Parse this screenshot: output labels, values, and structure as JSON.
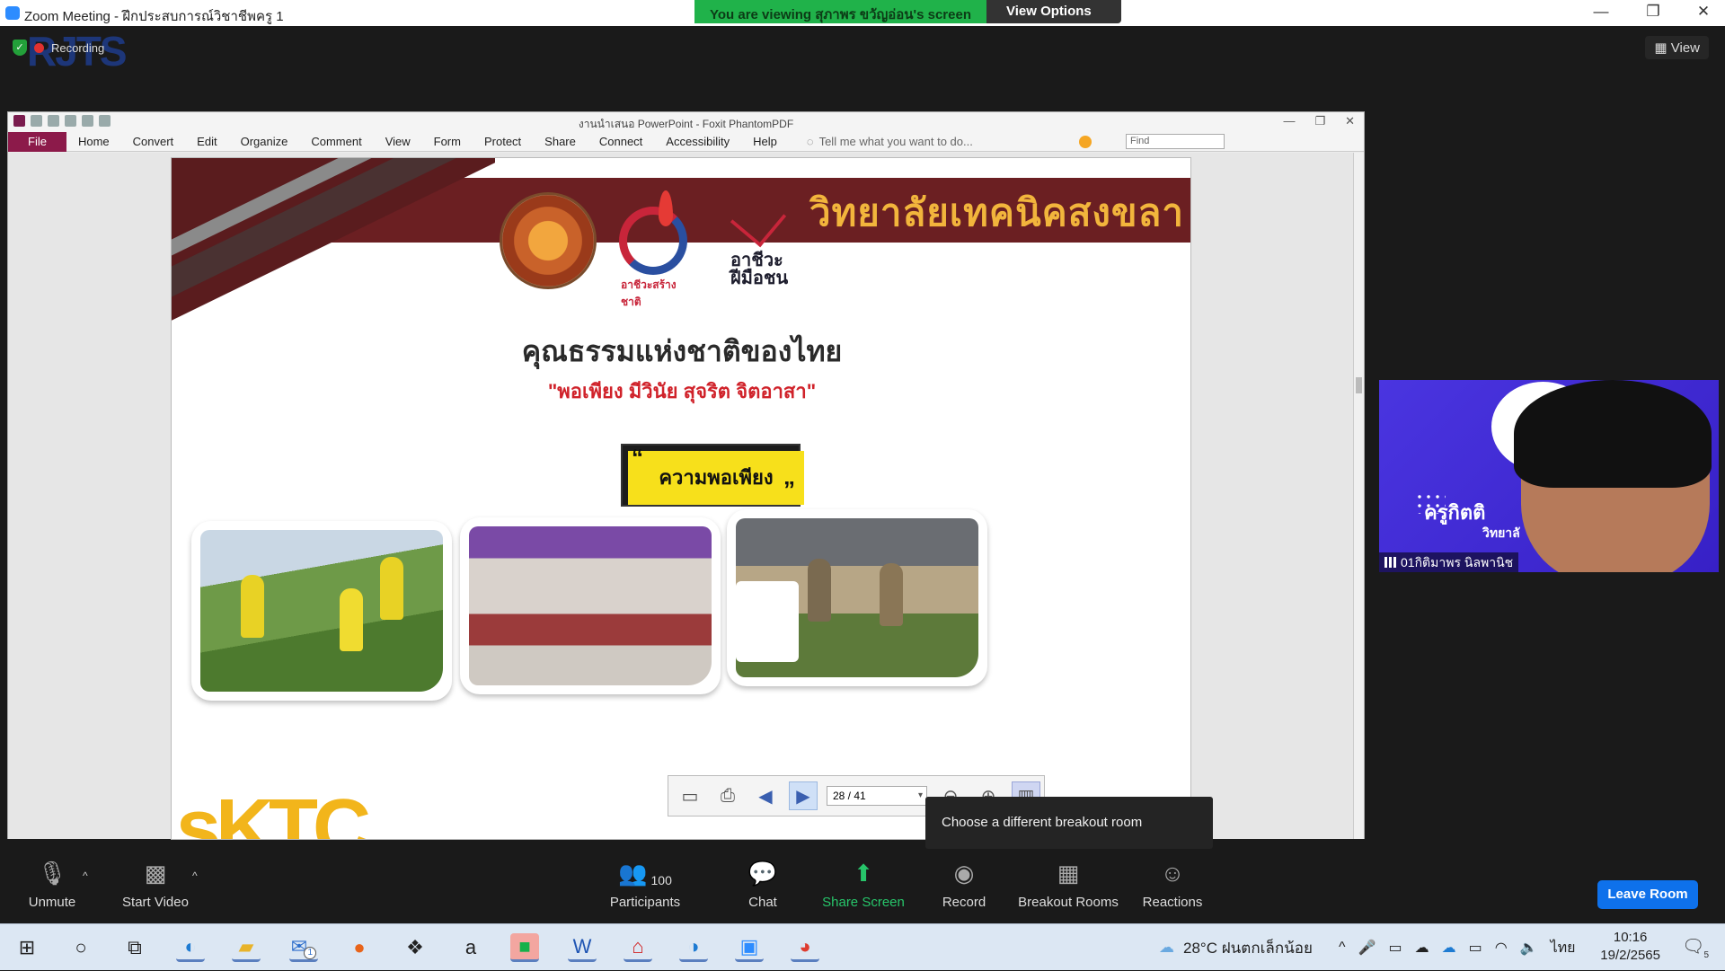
{
  "window": {
    "title": "Zoom Meeting - ฝึกประสบการณ์วิชาชีพครู 1",
    "minimize": "—",
    "restore": "❐",
    "close": "✕"
  },
  "viewing_banner": {
    "text": "You are viewing สุภาพร ขวัญอ่อน's screen",
    "options_label": "View Options ⌄"
  },
  "recording": {
    "label": "Recording"
  },
  "view_button": {
    "label": "View"
  },
  "watermark": {
    "text": "RJTS"
  },
  "foxit": {
    "title": "งานนำเสนอ PowerPoint - Foxit PhantomPDF",
    "menu": [
      "File",
      "Home",
      "Convert",
      "Edit",
      "Organize",
      "Comment",
      "View",
      "Form",
      "Protect",
      "Share",
      "Connect",
      "Accessibility",
      "Help"
    ],
    "tell_me": "Tell me what you want to do...",
    "find_placeholder": "Find"
  },
  "slide": {
    "college": "วิทยาลัยเทคนิคสงขลา",
    "logo2_caption": "อาชีวะสร้างชาติ",
    "logo3_caption": "อาชีวะ ฝีมือชน",
    "heading": "คุณธรรมแห่งชาติของไทย",
    "subheading": "\"พอเพียง  มีวินัย  สุจริต  จิตอาสา\"",
    "quote": "ความพอเพียง",
    "footer_logo": "sKTC"
  },
  "pdf_toolbar": {
    "page": "28 / 41"
  },
  "tooltip": {
    "text": "Choose a different breakout room"
  },
  "participant_video": {
    "name": "01กิติมาพร นิลพานิช",
    "overlay_title": "ครูกิตติ",
    "overlay_sub": "วิทยาลั"
  },
  "controls": {
    "unmute": "Unmute",
    "start_video": "Start Video",
    "participants": "Participants",
    "participants_count": "100",
    "chat": "Chat",
    "share_screen": "Share Screen",
    "record": "Record",
    "breakout_rooms": "Breakout Rooms",
    "reactions": "Reactions",
    "leave": "Leave Room"
  },
  "taskbar": {
    "weather": "28°C ฝนตกเล็กน้อย",
    "lang": "ไทย",
    "time": "10:16",
    "date": "19/2/2565",
    "notif_count": "5",
    "mail_badge": "1"
  },
  "colors": {
    "zoom_bg": "#1a1a1a",
    "share_green": "#27c56a",
    "leave_blue": "#0e71eb",
    "banner_maroon": "#6b1f22",
    "college_gold": "#f2b53c",
    "subhead_red": "#d0222a"
  }
}
